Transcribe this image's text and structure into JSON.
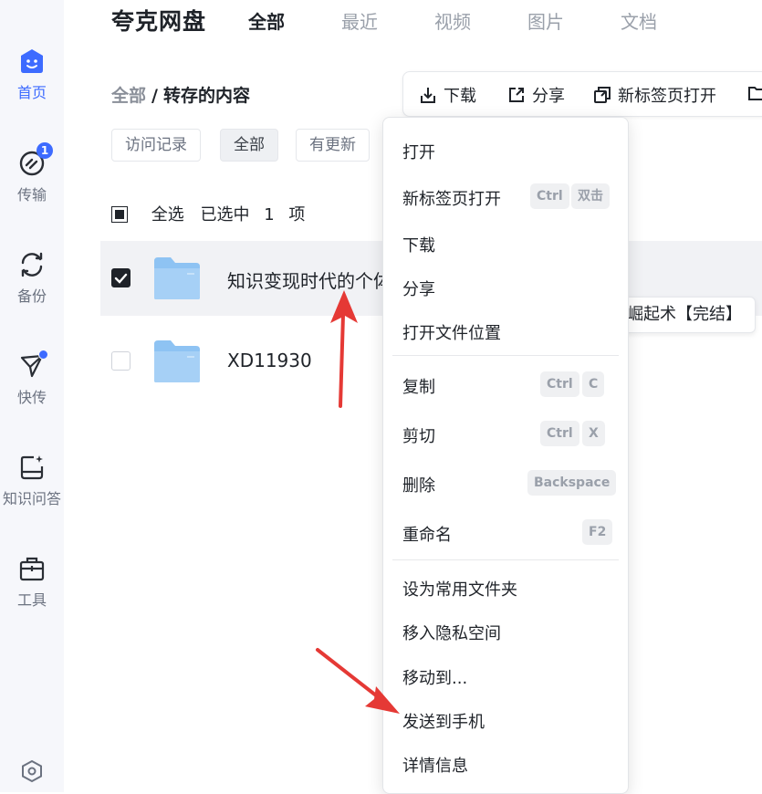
{
  "app": {
    "title": "夸克网盘"
  },
  "top_tabs": [
    {
      "label": "全部",
      "active": true
    },
    {
      "label": "最近"
    },
    {
      "label": "视频"
    },
    {
      "label": "图片"
    },
    {
      "label": "文档"
    }
  ],
  "sidebar": {
    "items": [
      {
        "label": "首页",
        "icon": "home-face-icon",
        "active": true
      },
      {
        "label": "传输",
        "icon": "transfer-icon",
        "badge": "1"
      },
      {
        "label": "备份",
        "icon": "backup-sync-icon"
      },
      {
        "label": "快传",
        "icon": "paper-plane-icon"
      },
      {
        "label": "知识问答",
        "icon": "knowledge-qa-icon"
      },
      {
        "label": "工具",
        "icon": "toolbox-icon"
      }
    ],
    "settings_icon": "settings-hexagon-icon"
  },
  "breadcrumb": {
    "root": "全部",
    "separator": "/",
    "current": "转存的内容"
  },
  "toolbar": {
    "download": "下载",
    "share": "分享",
    "open_new_tab": "新标签页打开"
  },
  "filters": [
    {
      "label": "访问记录"
    },
    {
      "label": "全部",
      "active": true
    },
    {
      "label": "有更新"
    }
  ],
  "selection": {
    "select_all": "全选",
    "selected_prefix": "已选中",
    "selected_count": "1",
    "selected_suffix": "项"
  },
  "files": [
    {
      "name": "知识变现时代的个体",
      "selected": true
    },
    {
      "name": "XD11930",
      "selected": false
    }
  ],
  "tooltip": {
    "text": "崛起术【完结】"
  },
  "context_menu": {
    "open": "打开",
    "open_new_tab": "新标签页打开",
    "open_new_tab_keys": [
      "Ctrl",
      "双击"
    ],
    "download": "下载",
    "share": "分享",
    "open_location": "打开文件位置",
    "copy": "复制",
    "copy_keys": [
      "Ctrl",
      "C"
    ],
    "cut": "剪切",
    "cut_keys": [
      "Ctrl",
      "X"
    ],
    "delete": "删除",
    "delete_key": "Backspace",
    "rename": "重命名",
    "rename_key": "F2",
    "set_favorite": "设为常用文件夹",
    "move_private": "移入隐私空间",
    "move_to": "移动到...",
    "send_to_phone": "发送到手机",
    "details": "详情信息"
  },
  "colors": {
    "accent": "#3d6bff",
    "annotation_arrow": "#e53935",
    "folder": "#8ec3f3"
  }
}
